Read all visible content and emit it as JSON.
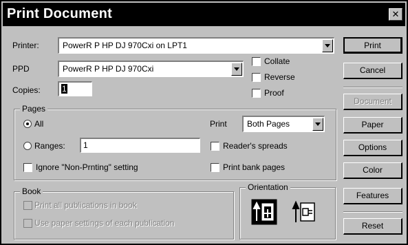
{
  "window": {
    "title": "Print Document",
    "close_glyph": "✕"
  },
  "printer": {
    "label": "Printer:",
    "value": "PowerR P HP DJ 970Cxi on LPT1"
  },
  "ppd": {
    "label": "PPD",
    "value": "PowerR P HP DJ 970Cxi"
  },
  "copies": {
    "label": "Copies:",
    "value": "1"
  },
  "options": {
    "collate": "Collate",
    "reverse": "Reverse",
    "proof": "Proof"
  },
  "pages": {
    "group_title": "Pages",
    "all_label": "All",
    "ranges_label": "Ranges:",
    "ranges_value": "1",
    "ignore_label": "Ignore \"Non-Prnting\" setting",
    "print_label": "Print",
    "print_value": "Both Pages",
    "readers_label": "Reader's spreads",
    "blank_label": "Print bank pages"
  },
  "book": {
    "group_title": "Book",
    "print_all": "Print all publications in book",
    "use_paper": "Use paper settings of each publication"
  },
  "orientation": {
    "group_title": "Orientation"
  },
  "buttons": {
    "print": "Print",
    "cancel": "Cancel",
    "document": "Document",
    "paper": "Paper",
    "options": "Options",
    "color": "Color",
    "features": "Features",
    "reset": "Reset"
  },
  "icons": {
    "portrait": "portrait-orientation-icon",
    "landscape": "landscape-orientation-icon"
  }
}
